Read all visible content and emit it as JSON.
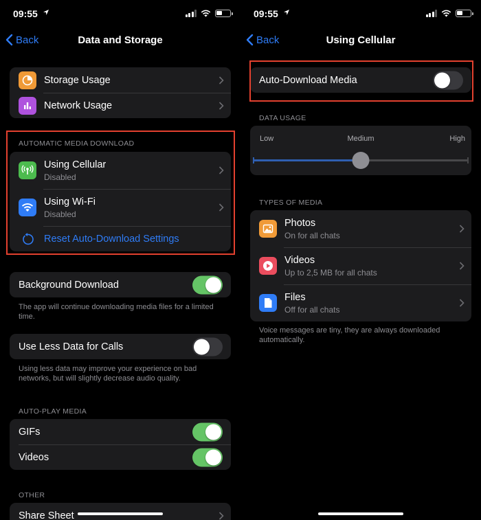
{
  "status": {
    "time": "09:55"
  },
  "left": {
    "back_label": "Back",
    "title": "Data and Storage",
    "storage_group": [
      {
        "label": "Storage Usage",
        "icon": "pie-chart-icon",
        "color": "#f09a37"
      },
      {
        "label": "Network Usage",
        "icon": "bar-chart-icon",
        "color": "#af52de"
      }
    ],
    "auto_media_header": "AUTOMATIC MEDIA DOWNLOAD",
    "auto_media": {
      "cellular": {
        "label": "Using Cellular",
        "sub": "Disabled",
        "icon": "antenna-icon",
        "color": "#4cbb4e"
      },
      "wifi": {
        "label": "Using Wi-Fi",
        "sub": "Disabled",
        "icon": "wifi-icon",
        "color": "#2f7cf6"
      },
      "reset": {
        "label": "Reset Auto-Download Settings"
      }
    },
    "background_download": {
      "label": "Background Download",
      "on": true
    },
    "background_footer": "The app will continue downloading media files for a limited time.",
    "less_data": {
      "label": "Use Less Data for Calls",
      "on": false
    },
    "less_data_footer": "Using less data may improve your experience on bad networks, but will slightly decrease audio quality.",
    "autoplay_header": "AUTO-PLAY MEDIA",
    "autoplay": [
      {
        "label": "GIFs",
        "on": true
      },
      {
        "label": "Videos",
        "on": true
      }
    ],
    "other_header": "OTHER",
    "share_sheet_label": "Share Sheet"
  },
  "right": {
    "back_label": "Back",
    "title": "Using Cellular",
    "auto_download": {
      "label": "Auto-Download Media",
      "on": false
    },
    "data_usage_header": "DATA USAGE",
    "slider": {
      "labels": [
        "Low",
        "Medium",
        "High"
      ],
      "value": "Medium",
      "position_fraction": 0.5
    },
    "types_header": "TYPES OF MEDIA",
    "media_types": [
      {
        "label": "Photos",
        "sub": "On for all chats",
        "icon": "photo-icon",
        "color": "#f09a37"
      },
      {
        "label": "Videos",
        "sub": "Up to 2,5 MB for all chats",
        "icon": "play-icon",
        "color": "#eb4d5e"
      },
      {
        "label": "Files",
        "sub": "Off for all chats",
        "icon": "file-icon",
        "color": "#2f7cf6"
      }
    ],
    "types_footer": "Voice messages are tiny, they are always downloaded automatically."
  },
  "colors": {
    "accent": "#2f7cf6",
    "toggle_on": "#65c466",
    "highlight": "#e4412f"
  }
}
